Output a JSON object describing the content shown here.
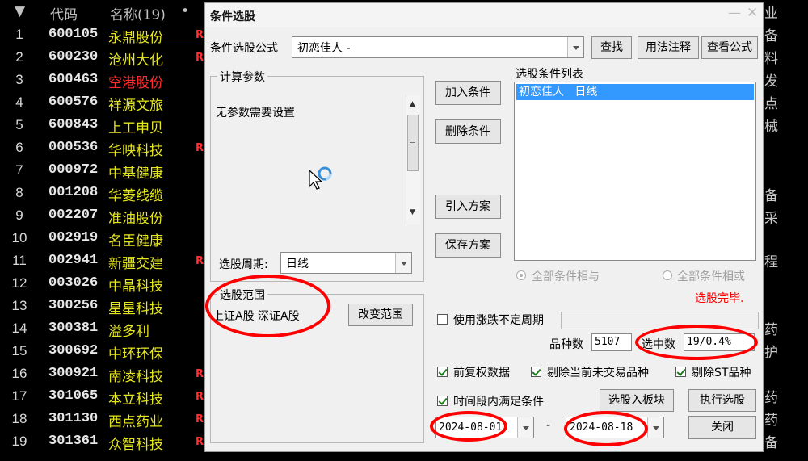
{
  "background_table": {
    "headers": {
      "num_marker": "▼",
      "code": "代码",
      "name": "名称(19)",
      "dot": "•"
    },
    "rows": [
      {
        "num": "1",
        "code": "600105",
        "name": "永鼎股份",
        "flag": "R",
        "red": false
      },
      {
        "num": "2",
        "code": "600230",
        "name": "沧州大化",
        "flag": "R",
        "red": false
      },
      {
        "num": "3",
        "code": "600463",
        "name": "空港股份",
        "flag": "",
        "red": true
      },
      {
        "num": "4",
        "code": "600576",
        "name": "祥源文旅",
        "flag": "",
        "red": false
      },
      {
        "num": "5",
        "code": "600843",
        "name": "上工申贝",
        "flag": "",
        "red": false
      },
      {
        "num": "6",
        "code": "000536",
        "name": "华映科技",
        "flag": "R",
        "red": false
      },
      {
        "num": "7",
        "code": "000972",
        "name": "中基健康",
        "flag": "",
        "red": false
      },
      {
        "num": "8",
        "code": "001208",
        "name": "华菱线缆",
        "flag": "",
        "red": false
      },
      {
        "num": "9",
        "code": "002207",
        "name": "准油股份",
        "flag": "",
        "red": false
      },
      {
        "num": "10",
        "code": "002919",
        "name": "名臣健康",
        "flag": "",
        "red": false
      },
      {
        "num": "11",
        "code": "002941",
        "name": "新疆交建",
        "flag": "R",
        "red": false
      },
      {
        "num": "12",
        "code": "003026",
        "name": "中晶科技",
        "flag": "",
        "red": false
      },
      {
        "num": "13",
        "code": "300256",
        "name": "星星科技",
        "flag": "",
        "red": false
      },
      {
        "num": "14",
        "code": "300381",
        "name": "溢多利",
        "flag": "",
        "red": false
      },
      {
        "num": "15",
        "code": "300692",
        "name": "中环环保",
        "flag": "",
        "red": false
      },
      {
        "num": "16",
        "code": "300921",
        "name": "南凌科技",
        "flag": "R",
        "red": false
      },
      {
        "num": "17",
        "code": "301065",
        "name": "本立科技",
        "flag": "R",
        "red": false
      },
      {
        "num": "18",
        "code": "301130",
        "name": "西点药业",
        "flag": "R",
        "red": false
      },
      {
        "num": "19",
        "code": "301361",
        "name": "众智科技",
        "flag": "R",
        "red": false
      }
    ],
    "right_column": [
      "业",
      "备",
      "料",
      "发",
      "点",
      "械",
      "备",
      "采",
      "程",
      "药",
      "护",
      "药",
      "药",
      "备"
    ]
  },
  "dialog": {
    "title": "条件选股",
    "formula_label": "条件选股公式",
    "formula_value": "初恋佳人  -",
    "find_button": "查找",
    "usage_button": "用法注释",
    "view_button": "查看公式",
    "params_group": "计算参数",
    "params_text": "无参数需要设置",
    "period_label": "选股周期:",
    "period_value": "日线",
    "add_condition": "加入条件",
    "delete_condition": "删除条件",
    "import_plan": "引入方案",
    "save_plan": "保存方案",
    "condition_list_label": "选股条件列表",
    "condition_items": [
      "初恋佳人   日线"
    ],
    "radio_and": "全部条件相与",
    "radio_or": "全部条件相或",
    "status_text": "选股完毕.",
    "range_group": "选股范围",
    "range_text": "上证A股  深证A股",
    "change_range": "改变范围",
    "use_variable_period": "使用涨跌不定周期",
    "variety_label": "品种数",
    "variety_value": "5107",
    "selected_label": "选中数",
    "selected_value": "19/0.4%",
    "fq_label": "前复权数据",
    "exclude_untraded": "剔除当前未交易品种",
    "exclude_st": "剔除ST品种",
    "time_range_label": "时间段内满足条件",
    "to_board": "选股入板块",
    "execute": "执行选股",
    "close": "关闭",
    "date_from": "2024-08-01",
    "date_sep": "-",
    "date_to": "2024-08-18"
  },
  "colors": {
    "annotation": "#ff0000",
    "stock_name": "#e6e61e",
    "status": "#ff0000",
    "selected_item_bg": "#3399ff"
  }
}
